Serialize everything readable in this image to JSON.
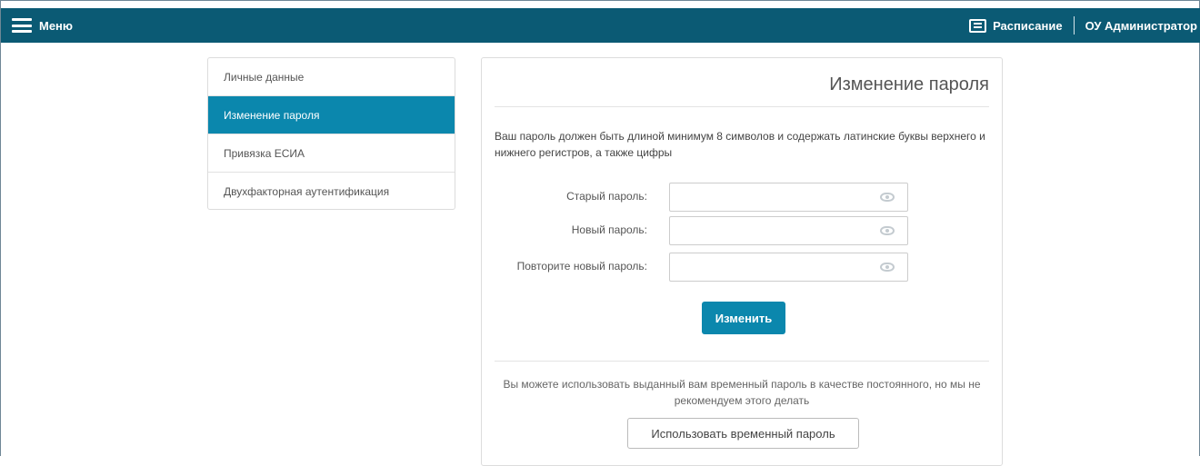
{
  "topbar": {
    "menu_label": "Меню",
    "schedule_label": "Расписание",
    "user_label": "ОУ Администратор",
    "color": "#0b5a74"
  },
  "sidebar": {
    "items": [
      {
        "label": "Личные данные",
        "active": false
      },
      {
        "label": "Изменение пароля",
        "active": true
      },
      {
        "label": "Привязка ЕСИА",
        "active": false
      },
      {
        "label": "Двухфакторная аутентификация",
        "active": false
      }
    ],
    "accent": "#0b87ad"
  },
  "main": {
    "title": "Изменение пароля",
    "info_text": "Ваш пароль должен быть длиной минимум 8 символов и содержать латинские буквы верхнего и нижнего регистров, а также цифры",
    "fields": [
      {
        "label": "Старый пароль:",
        "value": ""
      },
      {
        "label": "Новый пароль:",
        "value": ""
      },
      {
        "label": "Повторите новый пароль:",
        "value": ""
      }
    ],
    "submit_label": "Изменить",
    "temp_note": "Вы можете использовать выданный вам временный пароль в качестве постоянного, но мы не рекомендуем этого делать",
    "temp_button_label": "Использовать временный пароль"
  }
}
